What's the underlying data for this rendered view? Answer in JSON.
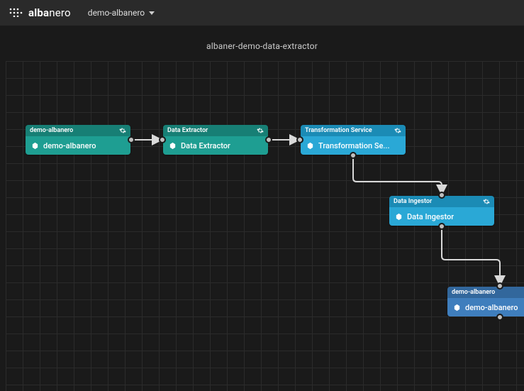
{
  "brand": {
    "bold": "alba",
    "light": "nero"
  },
  "workspace": {
    "selected": "demo-albanero"
  },
  "flow": {
    "title": "albaner-demo-data-extractor"
  },
  "nodes": {
    "n1": {
      "header": "demo-albanero",
      "label": "demo-albanero"
    },
    "n2": {
      "header": "Data Extractor",
      "label": "Data Extractor"
    },
    "n3": {
      "header": "Transformation Service",
      "label": "Transformation Se..."
    },
    "n4": {
      "header": "Data Ingestor",
      "label": "Data Ingestor"
    },
    "n5": {
      "header": "demo-albanero",
      "label": "demo-albanero"
    }
  },
  "colors": {
    "teal": "#1e9e92",
    "blue": "#2aa8d6",
    "steel": "#3f7ebd"
  }
}
